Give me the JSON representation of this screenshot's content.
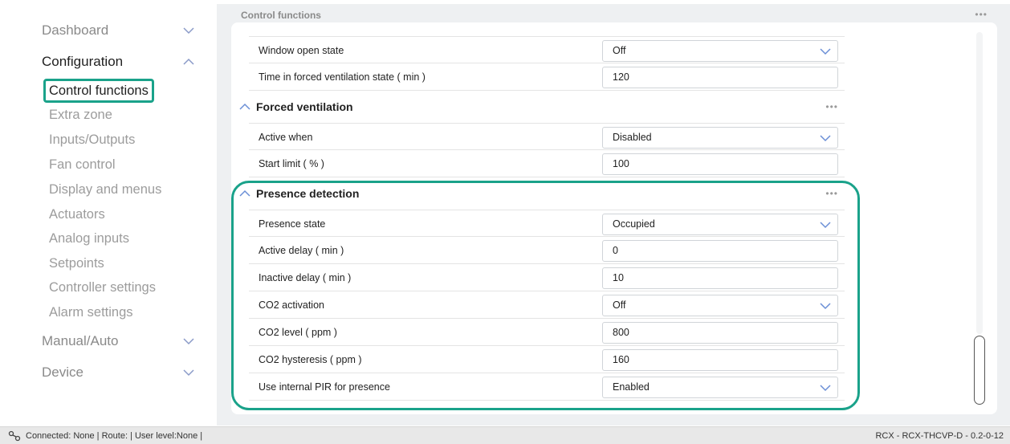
{
  "sidebar": {
    "dashboard": "Dashboard",
    "configuration": "Configuration",
    "items": [
      "Control functions",
      "Extra zone",
      "Inputs/Outputs",
      "Fan control",
      "Display and menus",
      "Actuators",
      "Analog inputs",
      "Setpoints",
      "Controller settings",
      "Alarm settings"
    ],
    "manual_auto": "Manual/Auto",
    "device": "Device"
  },
  "panel": {
    "title": "Control functions",
    "dots": "•••"
  },
  "rows_top": [
    {
      "label": "Window open state",
      "value": "Off"
    },
    {
      "label": "Time in forced ventilation state ( min )",
      "value": "120"
    }
  ],
  "forced_ventilation": {
    "title": "Forced ventilation",
    "rows": [
      {
        "label": "Active when",
        "value": "Disabled"
      },
      {
        "label": "Start limit ( % )",
        "value": "100"
      }
    ]
  },
  "presence_detection": {
    "title": "Presence detection",
    "rows": [
      {
        "label": "Presence state",
        "value": "Occupied"
      },
      {
        "label": "Active delay ( min )",
        "value": "0"
      },
      {
        "label": "Inactive delay ( min )",
        "value": "10"
      },
      {
        "label": "CO2 activation",
        "value": "Off"
      },
      {
        "label": "CO2 level ( ppm )",
        "value": "800"
      },
      {
        "label": "CO2 hysteresis ( ppm )",
        "value": "160"
      },
      {
        "label": "Use internal PIR for presence",
        "value": "Enabled"
      }
    ]
  },
  "statusbar": {
    "left": "Connected: None | Route: | User level:None |",
    "right": "RCX - RCX-THCVP-D - 0.2-0-12"
  },
  "colors": {
    "accent": "#1aa28a",
    "panel_bg": "#eef0f2",
    "chevron": "#6b8fd6"
  }
}
